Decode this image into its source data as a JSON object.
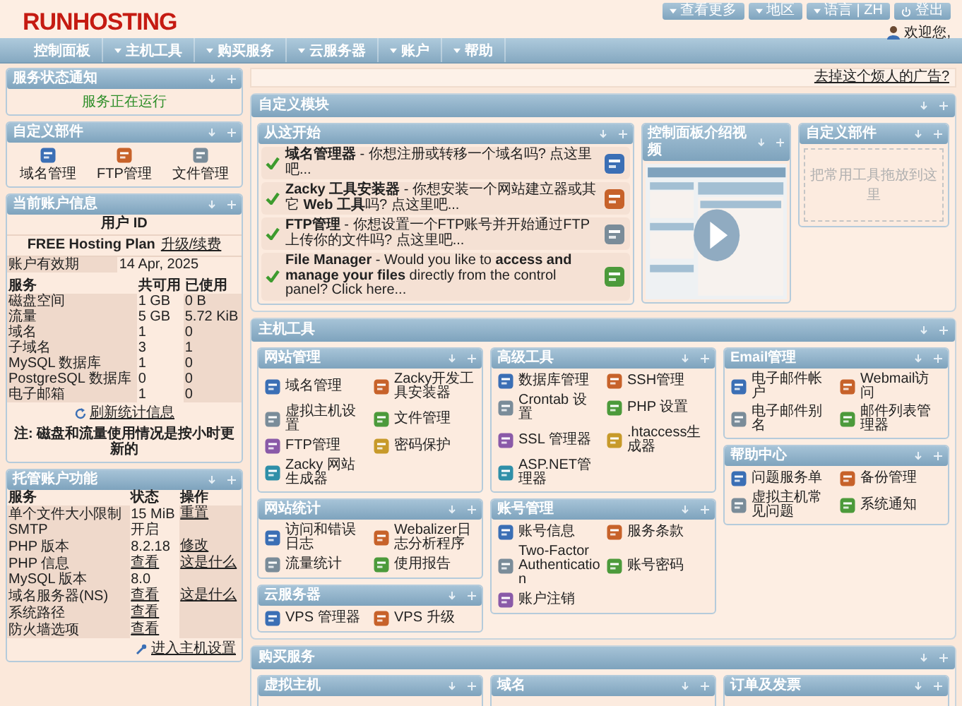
{
  "header": {
    "logo": "RUNHOSTING",
    "links": [
      {
        "label": "查看更多"
      },
      {
        "label": "地区"
      },
      {
        "label": "语言 | ZH"
      },
      {
        "label": "登出"
      }
    ],
    "welcome": "欢迎您,"
  },
  "nav": [
    {
      "label": "控制面板",
      "dropdown": false
    },
    {
      "label": "主机工具",
      "dropdown": true
    },
    {
      "label": "购买服务",
      "dropdown": true
    },
    {
      "label": "云服务器",
      "dropdown": true
    },
    {
      "label": "账户",
      "dropdown": true
    },
    {
      "label": "帮助",
      "dropdown": true
    }
  ],
  "sidebar": {
    "status_panel": {
      "title": "服务状态通知",
      "message": "服务正在运行"
    },
    "shortcuts_panel": {
      "title": "自定义部件",
      "tools": [
        {
          "label": "域名管理"
        },
        {
          "label": "FTP管理"
        },
        {
          "label": "文件管理"
        }
      ]
    },
    "account_panel": {
      "title": "当前账户信息",
      "user_label": "用户 ID",
      "plan": "FREE Hosting Plan",
      "plan_link": "升级/续费",
      "expiry_label": "账户有效期",
      "expiry": "14 Apr, 2025",
      "columns": [
        "服务",
        "共可用",
        "已使用"
      ],
      "rows": [
        [
          "磁盘空间",
          "1 GB",
          "0 B"
        ],
        [
          "流量",
          "5 GB",
          "5.72 KiB"
        ],
        [
          "域名",
          "1",
          "0"
        ],
        [
          "子域名",
          "3",
          "1"
        ],
        [
          "MySQL 数据库",
          "1",
          "0"
        ],
        [
          "PostgreSQL 数据库",
          "0",
          "0"
        ],
        [
          "电子邮箱",
          "1",
          "0"
        ]
      ],
      "refresh": "刷新统计信息",
      "note": "注: 磁盘和流量使用情况是按小时更新的"
    },
    "features_panel": {
      "title": "托管账户功能",
      "columns": [
        "服务",
        "状态",
        "操作"
      ],
      "rows": [
        [
          {
            "text": "单个文件大小限制",
            "link": false
          },
          {
            "text": "15 MiB",
            "link": false
          },
          {
            "text": "重置",
            "link": true
          }
        ],
        [
          {
            "text": "SMTP",
            "link": false
          },
          {
            "text": "开启",
            "link": false
          }
        ],
        [
          {
            "text": "PHP 版本",
            "link": false
          },
          {
            "text": "8.2.18",
            "link": false
          },
          {
            "text": "修改",
            "link": true
          }
        ],
        [
          {
            "text": "PHP 信息",
            "link": false
          },
          {
            "text": "查看",
            "link": true
          },
          {
            "text": "这是什么",
            "link": true
          }
        ],
        [
          {
            "text": "MySQL 版本",
            "link": false
          },
          {
            "text": "8.0",
            "link": false
          }
        ],
        [
          {
            "text": "域名服务器(NS)",
            "link": false
          },
          {
            "text": "查看",
            "link": true
          },
          {
            "text": "这是什么",
            "link": true
          }
        ],
        [
          {
            "text": "系统路径",
            "link": false
          },
          {
            "text": "查看",
            "link": true
          }
        ],
        [
          {
            "text": "防火墙选项",
            "link": false
          },
          {
            "text": "查看",
            "link": true
          }
        ]
      ],
      "footer_link": "进入主机设置"
    }
  },
  "ad_link": "去掉这个烦人的广告?",
  "sections": [
    {
      "kind": "widgets",
      "title": "自定义模块",
      "widgets": [
        {
          "kind": "start",
          "title": "从这开始",
          "items": [
            {
              "text": "**域名管理器** - 你想注册或转移一个域名吗? 点这里吧..."
            },
            {
              "text": "**Zacky 工具安装器** - 你想安装一个网站建立器或其它 **Web 工具**吗? 点这里吧..."
            },
            {
              "text": "**FTP管理** - 你想设置一个FTP账号并开始通过FTP上传你的文件吗? 点这里吧..."
            },
            {
              "text": "**File Manager** - Would you like to **access and manage your files** directly from the control panel? Click here..."
            }
          ]
        },
        {
          "kind": "video",
          "title": "控制面板介绍视频"
        },
        {
          "kind": "dropzone",
          "title": "自定义部件",
          "placeholder": "把常用工具拖放到这里"
        }
      ]
    },
    {
      "kind": "tools",
      "title": "主机工具",
      "columns": [
        [
          {
            "title": "网站管理",
            "tools": [
              {
                "label": "域名管理"
              },
              {
                "label": "Zacky开发工具安装器"
              },
              {
                "label": "虚拟主机设置"
              },
              {
                "label": "文件管理"
              },
              {
                "label": "FTP管理"
              },
              {
                "label": "密码保护"
              },
              {
                "label": "Zacky 网站生成器"
              }
            ]
          },
          {
            "title": "网站统计",
            "tools": [
              {
                "label": "访问和错误日志"
              },
              {
                "label": "Webalizer日志分析程序"
              },
              {
                "label": "流量统计"
              },
              {
                "label": "使用报告"
              }
            ]
          },
          {
            "title": "云服务器",
            "tools": [
              {
                "label": "VPS 管理器"
              },
              {
                "label": "VPS 升级"
              }
            ]
          }
        ],
        [
          {
            "title": "高级工具",
            "tools": [
              {
                "label": "数据库管理"
              },
              {
                "label": "SSH管理"
              },
              {
                "label": "Crontab 设置"
              },
              {
                "label": "PHP 设置"
              },
              {
                "label": "SSL 管理器"
              },
              {
                "label": ".htaccess生成器"
              },
              {
                "label": "ASP.NET管理器"
              }
            ]
          },
          {
            "title": "账号管理",
            "tools": [
              {
                "label": "账号信息"
              },
              {
                "label": "服务条款"
              },
              {
                "label": "Two-Factor Authentication"
              },
              {
                "label": "账号密码"
              },
              {
                "label": "账户注销"
              }
            ]
          }
        ],
        [
          {
            "title": "Email管理",
            "tools": [
              {
                "label": "电子邮件帐户"
              },
              {
                "label": "Webmail访问"
              },
              {
                "label": "电子邮件别名"
              },
              {
                "label": "邮件列表管理器"
              }
            ]
          },
          {
            "title": "帮助中心",
            "tools": [
              {
                "label": "问题服务单"
              },
              {
                "label": "备份管理"
              },
              {
                "label": "虚拟主机常见问题"
              },
              {
                "label": "系统通知"
              }
            ]
          }
        ]
      ]
    },
    {
      "kind": "tools",
      "title": "购买服务",
      "columns": [
        [
          {
            "title": "虚拟主机"
          }
        ],
        [
          {
            "title": "域名"
          }
        ],
        [
          {
            "title": "订单及发票"
          }
        ]
      ]
    }
  ]
}
